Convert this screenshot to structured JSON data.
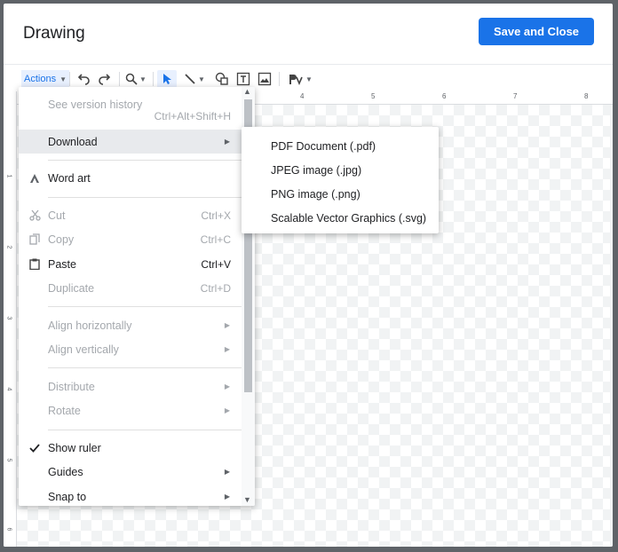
{
  "dialog": {
    "title": "Drawing",
    "save_button": "Save and Close"
  },
  "toolbar": {
    "actions_label": "Actions",
    "icons": [
      "undo-icon",
      "redo-icon",
      "zoom-icon",
      "select-icon",
      "line-icon",
      "shape-icon",
      "textbox-icon",
      "image-icon",
      "format-painter-icon"
    ]
  },
  "ruler": {
    "horizontal": [
      "4",
      "5",
      "6",
      "7",
      "8"
    ],
    "vertical": [
      "1",
      "2",
      "3",
      "4",
      "5",
      "6"
    ]
  },
  "menu": {
    "version_history": "See version history",
    "version_history_shortcut": "Ctrl+Alt+Shift+H",
    "download": "Download",
    "word_art": "Word art",
    "cut": "Cut",
    "cut_shortcut": "Ctrl+X",
    "copy": "Copy",
    "copy_shortcut": "Ctrl+C",
    "paste": "Paste",
    "paste_shortcut": "Ctrl+V",
    "duplicate": "Duplicate",
    "duplicate_shortcut": "Ctrl+D",
    "align_horizontally": "Align horizontally",
    "align_vertically": "Align vertically",
    "distribute": "Distribute",
    "rotate": "Rotate",
    "show_ruler": "Show ruler",
    "guides": "Guides",
    "snap_to": "Snap to"
  },
  "download_submenu": {
    "pdf": "PDF Document (.pdf)",
    "jpg": "JPEG image (.jpg)",
    "png": "PNG image (.png)",
    "svg": "Scalable Vector Graphics (.svg)"
  },
  "colors": {
    "accent": "#1a73e8",
    "disabled_text": "#a4a8ad"
  }
}
